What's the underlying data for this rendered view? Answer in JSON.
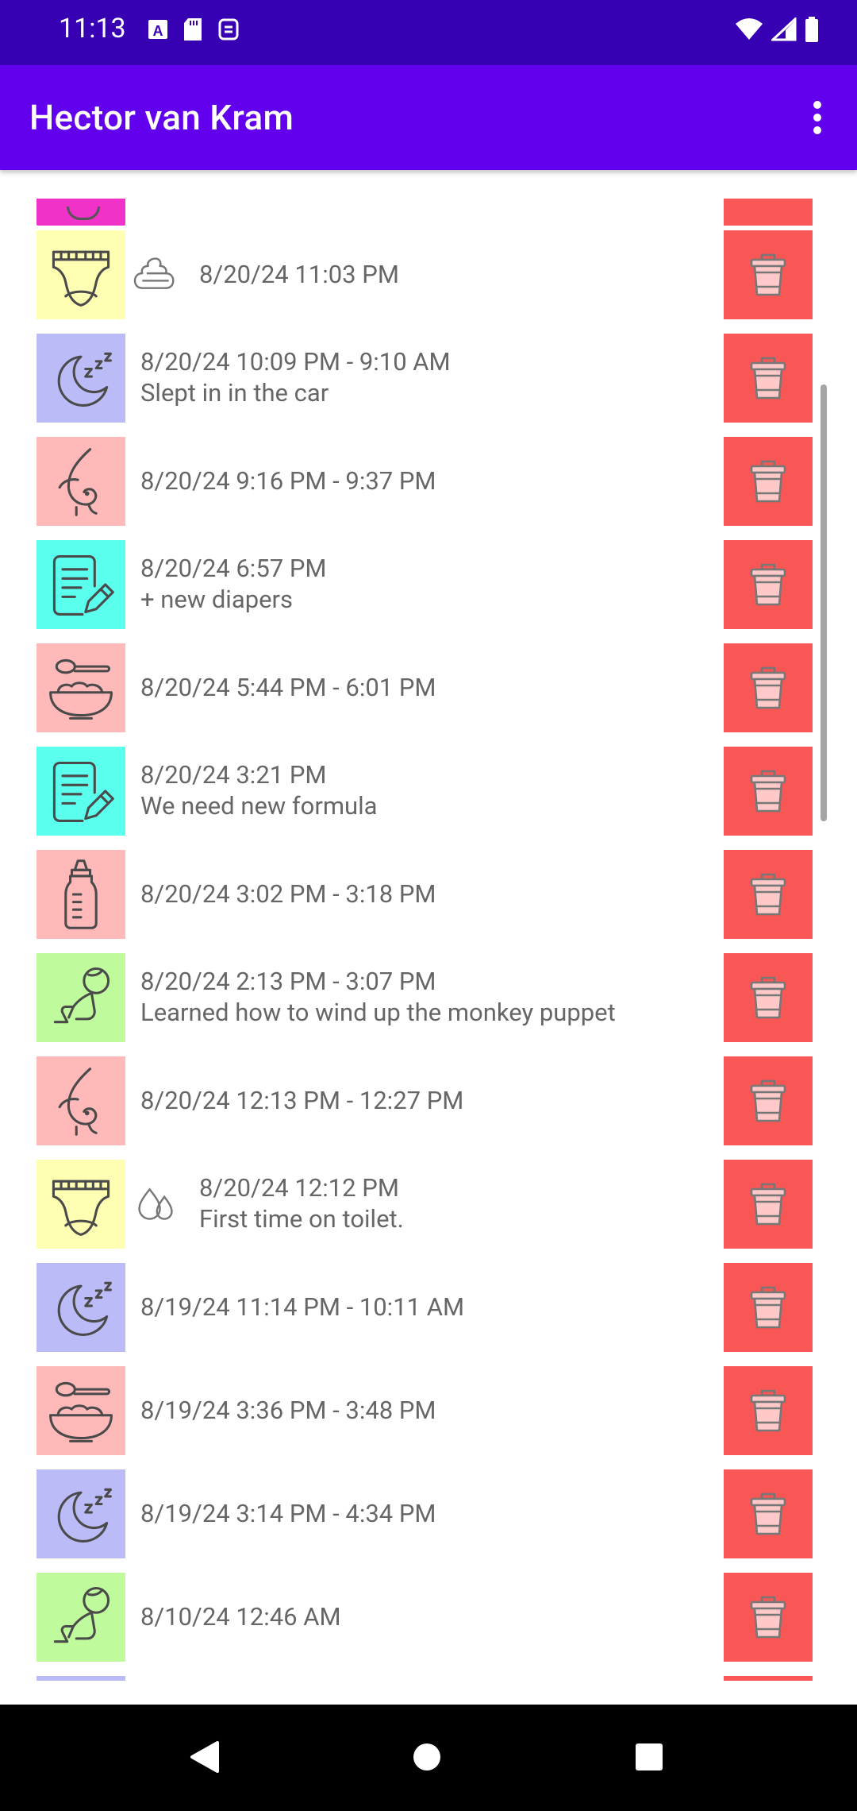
{
  "status_bar": {
    "time": "11:13",
    "left_icons": [
      "a-box-icon",
      "sd-card-icon",
      "sync-icon"
    ],
    "right_icons": [
      "wifi-icon",
      "signal-icon",
      "battery-icon"
    ]
  },
  "app_bar": {
    "title": "Hector van Kram",
    "overflow_icon": "more-vert-icon"
  },
  "category_colors": {
    "diaper": "#FFFFB4",
    "sleep": "#BBBBF7",
    "breastfeed": "#FFB9B9",
    "note": "#5AFFEE",
    "food": "#FFB9B9",
    "bottle": "#FFB9B9",
    "play": "#BFFB9D",
    "delete": "#F95656",
    "partial_top": "#F032C8"
  },
  "entries": [
    {
      "category": "diaper",
      "icon": "diaper-icon",
      "sub_icon": "poop-icon",
      "line1": "8/20/24  11:03 PM",
      "line2": ""
    },
    {
      "category": "sleep",
      "icon": "moon-zzz-icon",
      "sub_icon": "",
      "line1": "8/20/24  10:09 PM - 9:10 AM",
      "line2": "Slept in in the car"
    },
    {
      "category": "breastfeed",
      "icon": "breastfeed-icon",
      "sub_icon": "",
      "line1": "8/20/24  9:16 PM - 9:37 PM",
      "line2": ""
    },
    {
      "category": "note",
      "icon": "note-pen-icon",
      "sub_icon": "",
      "line1": "8/20/24  6:57 PM",
      "line2": "+ new diapers"
    },
    {
      "category": "food",
      "icon": "bowl-spoon-icon",
      "sub_icon": "",
      "line1": "8/20/24  5:44 PM - 6:01 PM",
      "line2": ""
    },
    {
      "category": "note",
      "icon": "note-pen-icon",
      "sub_icon": "",
      "line1": "8/20/24  3:21 PM",
      "line2": "We need new formula"
    },
    {
      "category": "bottle",
      "icon": "baby-bottle-icon",
      "sub_icon": "",
      "line1": "8/20/24  3:02 PM - 3:18 PM",
      "line2": ""
    },
    {
      "category": "play",
      "icon": "crawling-baby-icon",
      "sub_icon": "",
      "line1": "8/20/24  2:13 PM - 3:07 PM",
      "line2": "Learned how to wind up the monkey puppet"
    },
    {
      "category": "breastfeed",
      "icon": "breastfeed-icon",
      "sub_icon": "",
      "line1": "8/20/24  12:13 PM - 12:27 PM",
      "line2": ""
    },
    {
      "category": "diaper",
      "icon": "diaper-icon",
      "sub_icon": "drops-icon",
      "line1": "8/20/24  12:12 PM",
      "line2": "First time on toilet."
    },
    {
      "category": "sleep",
      "icon": "moon-zzz-icon",
      "sub_icon": "",
      "line1": "8/19/24  11:14 PM - 10:11 AM",
      "line2": ""
    },
    {
      "category": "food",
      "icon": "bowl-spoon-icon",
      "sub_icon": "",
      "line1": "8/19/24  3:36 PM - 3:48 PM",
      "line2": ""
    },
    {
      "category": "sleep",
      "icon": "moon-zzz-icon",
      "sub_icon": "",
      "line1": "8/19/24  3:14 PM - 4:34 PM",
      "line2": ""
    },
    {
      "category": "play",
      "icon": "crawling-baby-icon",
      "sub_icon": "",
      "line1": "8/10/24  12:46 AM",
      "line2": ""
    }
  ],
  "delete_icon": "trash-icon",
  "nav_bar": {
    "back_icon": "back-triangle-icon",
    "home_icon": "home-circle-icon",
    "recents_icon": "recents-square-icon"
  }
}
